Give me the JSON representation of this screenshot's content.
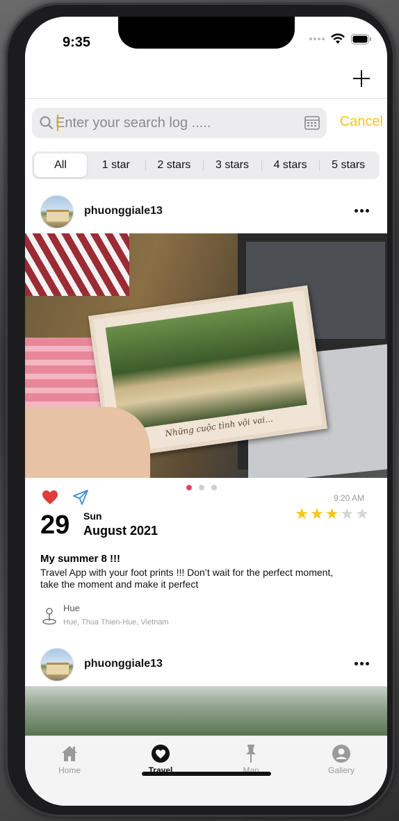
{
  "status_bar": {
    "time": "9:35"
  },
  "search": {
    "placeholder": "Enter your search log .....",
    "value": "",
    "cancel_label": "Cancel"
  },
  "filters": [
    "All",
    "1 star",
    "2 stars",
    "3 stars",
    "4 stars",
    "5 stars"
  ],
  "active_filter": "All",
  "posts": [
    {
      "username": "phuonggiale13",
      "photo_caption": "Những cuộc tình vội vai...",
      "time": "9:20 AM",
      "rating": 3,
      "rating_max": 5,
      "day_number": "29",
      "day_name": "Sun",
      "month_year": "August 2021",
      "title": "My summer 8 !!!",
      "body": "Travel App with your foot prints  !!! Don’t wait for the perfect moment, take the moment and make it perfect",
      "location_name": "Hue",
      "location_detail": "Hue, Thua Thien-Hue, Vietnam",
      "image_index": 1,
      "image_count": 3
    },
    {
      "username": "phuonggiale13"
    }
  ],
  "tabs": [
    {
      "label": "Home",
      "icon": "home-icon"
    },
    {
      "label": "Travel",
      "icon": "heart-circle-icon"
    },
    {
      "label": "Map",
      "icon": "pin-icon"
    },
    {
      "label": "Gallery",
      "icon": "person-circle-icon"
    }
  ],
  "active_tab": "Travel",
  "colors": {
    "accent": "#f5c518",
    "heart": "#e03a3a",
    "send": "#3b8ed8",
    "page_dot_active": "#e04565"
  }
}
